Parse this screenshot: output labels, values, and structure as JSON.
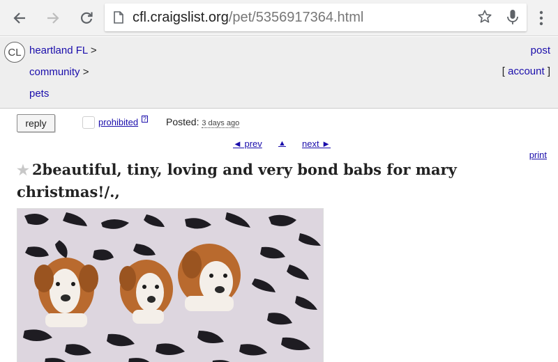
{
  "browser": {
    "url_host": "cfl.craigslist.org",
    "url_path": "/pet/5356917364.html"
  },
  "header": {
    "logo": "CL",
    "breadcrumbs": [
      "heartland FL",
      "community",
      "pets"
    ],
    "separator": ">",
    "post_label": "post",
    "account_label": "account",
    "bracket_open": "[",
    "bracket_close": "]"
  },
  "actions": {
    "reply_label": "reply",
    "prohibited_label": "prohibited",
    "help_label": "?",
    "posted_label": "Posted:",
    "posted_ago": "3 days ago"
  },
  "pager": {
    "prev_label": "◄ prev",
    "up_label": "▲",
    "next_label": "next ►",
    "print_label": "print"
  },
  "listing": {
    "title": "2beautiful, tiny, loving and very bond babs for mary christmas!/.,",
    "photo": {
      "subject": "three bulldog puppies on leopard-print blanket",
      "colors": {
        "puppy": "#b96a2e",
        "white": "#f4efe9",
        "pattern_dark": "#1e1c22",
        "pattern_light": "#ddd6df"
      }
    }
  },
  "icons": [
    "back-arrow-icon",
    "forward-arrow-icon",
    "reload-icon",
    "page-icon",
    "bookmark-star-icon",
    "mic-icon",
    "menu-dots-icon",
    "favorite-star-icon"
  ],
  "colors": {
    "link": "#1a0dab",
    "header_bg": "#eeeeee",
    "chrome_bg": "#f2f2f2"
  }
}
